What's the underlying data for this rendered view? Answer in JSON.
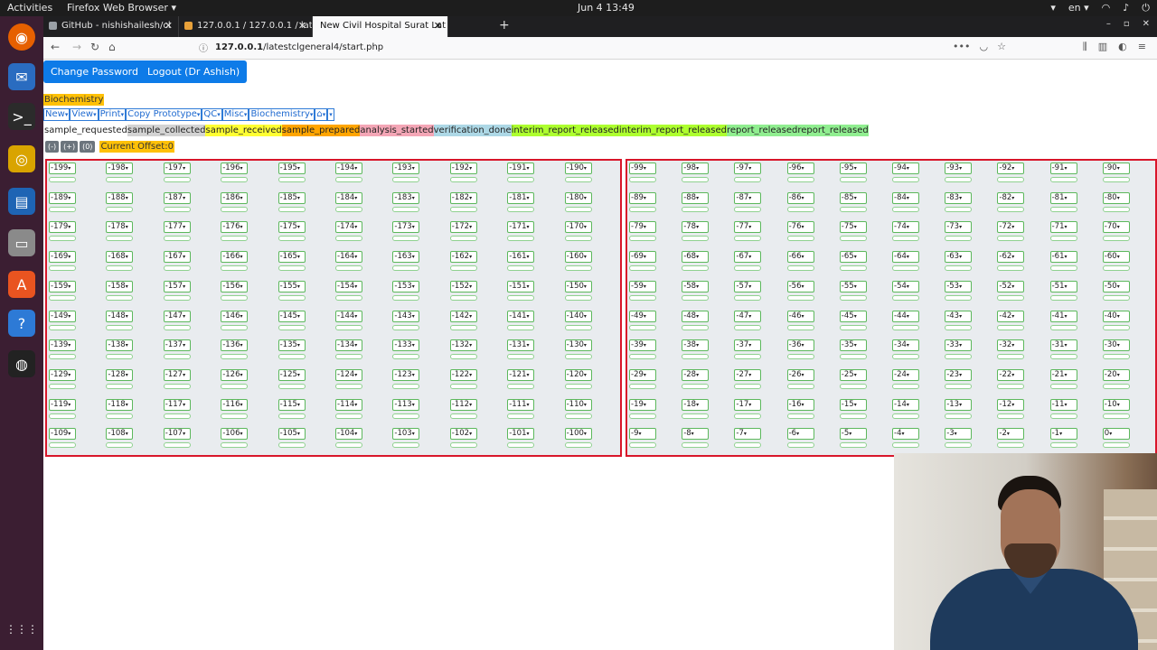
{
  "os_bar": {
    "activities": "Activities",
    "app_name": "Firefox Web Browser ▾",
    "clock": "Jun 4  13:49",
    "lang": "en ▾"
  },
  "browser": {
    "tabs": [
      {
        "label": "GitHub - nishishailesh/cl",
        "close": "✕",
        "fav_color": "#9aa0a6"
      },
      {
        "label": "127.0.0.1 / 127.0.0.1 / lat",
        "close": "✕",
        "fav_color": "#e8a13a"
      },
      {
        "label": "New Civil Hospital Surat Lat",
        "close": "✕",
        "fav_color": "#9aa0a6"
      }
    ],
    "new_tab": "+",
    "url_host": "127.0.0.1",
    "url_path": "/latestclgeneral4/start.php"
  },
  "header": {
    "change_password": "Change Password",
    "logout": "Logout (Dr Ashish)"
  },
  "department": "Biochemistry",
  "menu": [
    "New",
    "View",
    "Print",
    "Copy Prototype",
    "QC",
    "Misc",
    "Biochemistry",
    "⌂",
    ""
  ],
  "legend": [
    {
      "label": "sample_requested",
      "color": "#ffffff"
    },
    {
      "label": "sample_collected",
      "color": "#d3d3d3"
    },
    {
      "label": "sample_received",
      "color": "#ffff33"
    },
    {
      "label": "sample_prepared",
      "color": "#ffa500"
    },
    {
      "label": "analysis_started",
      "color": "#f4a6b6"
    },
    {
      "label": "verification_done",
      "color": "#add8e6"
    },
    {
      "label": "interim_report_released",
      "color": "#adff2f"
    },
    {
      "label": "interim_report_released",
      "color": "#adff2f"
    },
    {
      "label": "report_released",
      "color": "#90ee90"
    },
    {
      "label": "report_released",
      "color": "#90ee90"
    }
  ],
  "offset_controls": {
    "minus": "(-)",
    "plus": "(+)",
    "zero": "(0)",
    "label": "Current Offset:0"
  },
  "left_grid": [
    [
      "-199",
      "-198",
      "-197",
      "-196",
      "-195",
      "-194",
      "-193",
      "-192",
      "-191",
      "-190"
    ],
    [
      "-189",
      "-188",
      "-187",
      "-186",
      "-185",
      "-184",
      "-183",
      "-182",
      "-181",
      "-180"
    ],
    [
      "-179",
      "-178",
      "-177",
      "-176",
      "-175",
      "-174",
      "-173",
      "-172",
      "-171",
      "-170"
    ],
    [
      "-169",
      "-168",
      "-167",
      "-166",
      "-165",
      "-164",
      "-163",
      "-162",
      "-161",
      "-160"
    ],
    [
      "-159",
      "-158",
      "-157",
      "-156",
      "-155",
      "-154",
      "-153",
      "-152",
      "-151",
      "-150"
    ],
    [
      "-149",
      "-148",
      "-147",
      "-146",
      "-145",
      "-144",
      "-143",
      "-142",
      "-141",
      "-140"
    ],
    [
      "-139",
      "-138",
      "-137",
      "-136",
      "-135",
      "-134",
      "-133",
      "-132",
      "-131",
      "-130"
    ],
    [
      "-129",
      "-128",
      "-127",
      "-126",
      "-125",
      "-124",
      "-123",
      "-122",
      "-121",
      "-120"
    ],
    [
      "-119",
      "-118",
      "-117",
      "-116",
      "-115",
      "-114",
      "-113",
      "-112",
      "-111",
      "-110"
    ],
    [
      "-109",
      "-108",
      "-107",
      "-106",
      "-105",
      "-104",
      "-103",
      "-102",
      "-101",
      "-100"
    ]
  ],
  "right_grid": [
    [
      "-99",
      "-98",
      "-97",
      "-96",
      "-95",
      "-94",
      "-93",
      "-92",
      "-91",
      "-90"
    ],
    [
      "-89",
      "-88",
      "-87",
      "-86",
      "-85",
      "-84",
      "-83",
      "-82",
      "-81",
      "-80"
    ],
    [
      "-79",
      "-78",
      "-77",
      "-76",
      "-75",
      "-74",
      "-73",
      "-72",
      "-71",
      "-70"
    ],
    [
      "-69",
      "-68",
      "-67",
      "-66",
      "-65",
      "-64",
      "-63",
      "-62",
      "-61",
      "-60"
    ],
    [
      "-59",
      "-58",
      "-57",
      "-56",
      "-55",
      "-54",
      "-53",
      "-52",
      "-51",
      "-50"
    ],
    [
      "-49",
      "-48",
      "-47",
      "-46",
      "-45",
      "-44",
      "-43",
      "-42",
      "-41",
      "-40"
    ],
    [
      "-39",
      "-38",
      "-37",
      "-36",
      "-35",
      "-34",
      "-33",
      "-32",
      "-31",
      "-30"
    ],
    [
      "-29",
      "-28",
      "-27",
      "-26",
      "-25",
      "-24",
      "-23",
      "-22",
      "-21",
      "-20"
    ],
    [
      "-19",
      "-18",
      "-17",
      "-16",
      "-15",
      "-14",
      "-13",
      "-12",
      "-11",
      "-10"
    ],
    [
      "-9",
      "-8",
      "-7",
      "-6",
      "-5",
      "-4",
      "-3",
      "-2",
      "-1",
      "0"
    ]
  ],
  "dock_icons": [
    {
      "name": "firefox-icon",
      "glyph": "◉",
      "color": "#e66000"
    },
    {
      "name": "thunderbird-icon",
      "glyph": "✉",
      "color": "#2a6cc0"
    },
    {
      "name": "terminal-icon",
      "glyph": ">_",
      "color": "#2b2b2b"
    },
    {
      "name": "rhythmbox-icon",
      "glyph": "◎",
      "color": "#d9a400"
    },
    {
      "name": "libreoffice-writer-icon",
      "glyph": "▤",
      "color": "#1e64b4"
    },
    {
      "name": "files-icon",
      "glyph": "▭",
      "color": "#8a8a8a"
    },
    {
      "name": "software-center-icon",
      "glyph": "A",
      "color": "#e95420"
    },
    {
      "name": "help-icon",
      "glyph": "?",
      "color": "#2d7ad6"
    },
    {
      "name": "obs-icon",
      "glyph": "◍",
      "color": "#222222"
    }
  ],
  "dock_apps_grid": "⋮⋮⋮"
}
